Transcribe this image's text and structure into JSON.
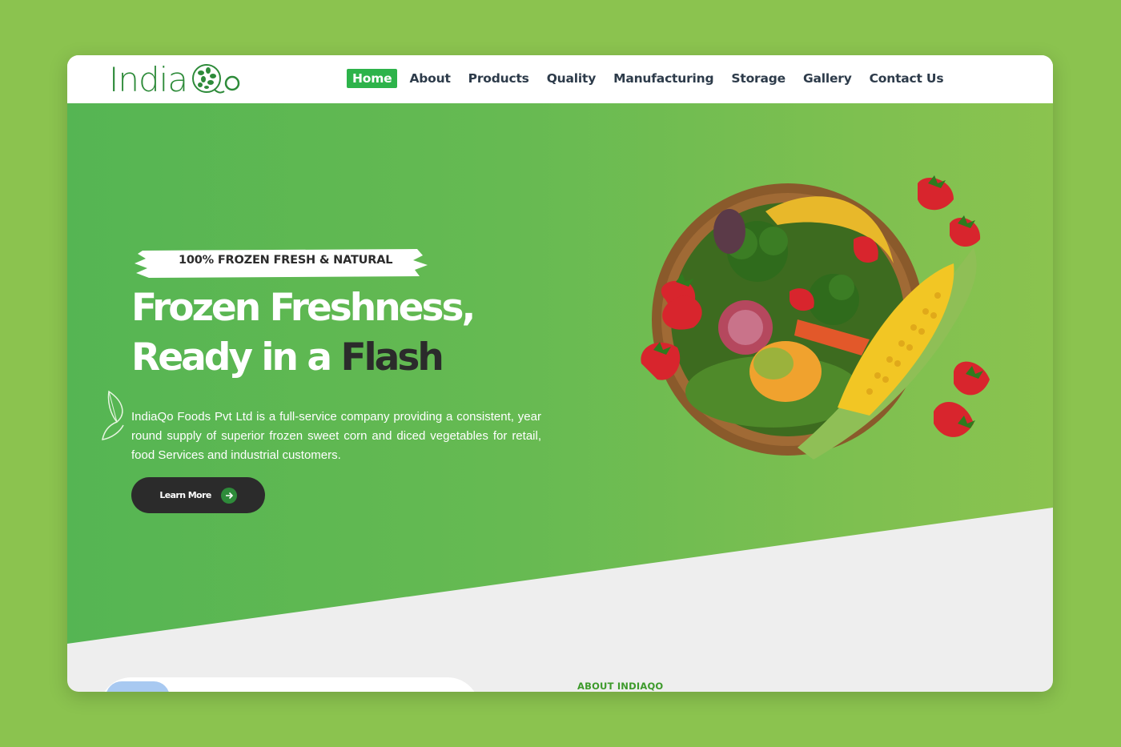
{
  "brand": {
    "logo_text": "India",
    "logo_suffix": "Qo"
  },
  "nav": {
    "items": [
      {
        "label": "Home",
        "active": true
      },
      {
        "label": "About"
      },
      {
        "label": "Products"
      },
      {
        "label": "Quality"
      },
      {
        "label": "Manufacturing"
      },
      {
        "label": "Storage"
      },
      {
        "label": "Gallery"
      },
      {
        "label": "Contact Us"
      }
    ]
  },
  "hero": {
    "badge": "100% FROZEN FRESH & NATURAL",
    "headline_line1": "Frozen Freshness,",
    "headline_line2_light": "Ready in a",
    "headline_line2_dark": "Flash",
    "description": "IndiaQo Foods Pvt Ltd is a full-service company providing a consistent, year round supply of superior frozen sweet corn and diced vegetables for retail, food Services and industrial customers.",
    "cta_label": "Learn More"
  },
  "about": {
    "label": "ABOUT INDIAQO"
  },
  "colors": {
    "page_bg": "#8bc34f",
    "hero_start": "#55b553",
    "hero_end": "#8bc34f",
    "nav_active": "#2db34a",
    "dark": "#2b2b2b",
    "brand_green": "#2e8b3a"
  },
  "icons": [
    "basket-of-vegetables-image",
    "leaf-outline-icon",
    "arrow-right-icon",
    "logo-seed-icon"
  ]
}
